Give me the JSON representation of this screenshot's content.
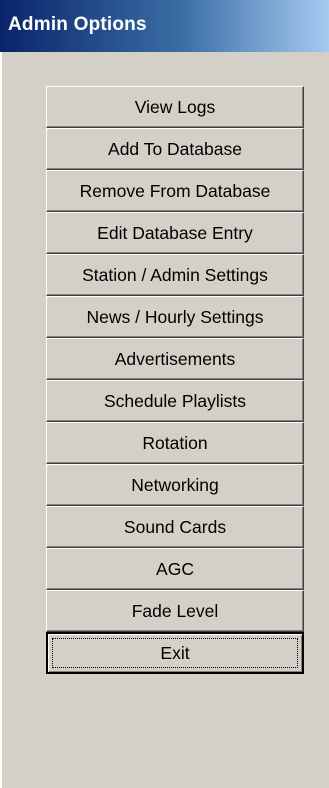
{
  "window": {
    "title": "Admin Options"
  },
  "buttons": [
    {
      "label": "View Logs"
    },
    {
      "label": "Add To Database"
    },
    {
      "label": "Remove From Database"
    },
    {
      "label": "Edit Database Entry"
    },
    {
      "label": "Station / Admin Settings"
    },
    {
      "label": "News / Hourly Settings"
    },
    {
      "label": "Advertisements"
    },
    {
      "label": "Schedule Playlists"
    },
    {
      "label": "Rotation"
    },
    {
      "label": "Networking"
    },
    {
      "label": "Sound Cards"
    },
    {
      "label": "AGC"
    },
    {
      "label": "Fade Level"
    },
    {
      "label": "Exit"
    }
  ],
  "colors": {
    "titlebar_start": "#0a246a",
    "titlebar_end": "#a6caf0",
    "face": "#d4d0c8"
  }
}
